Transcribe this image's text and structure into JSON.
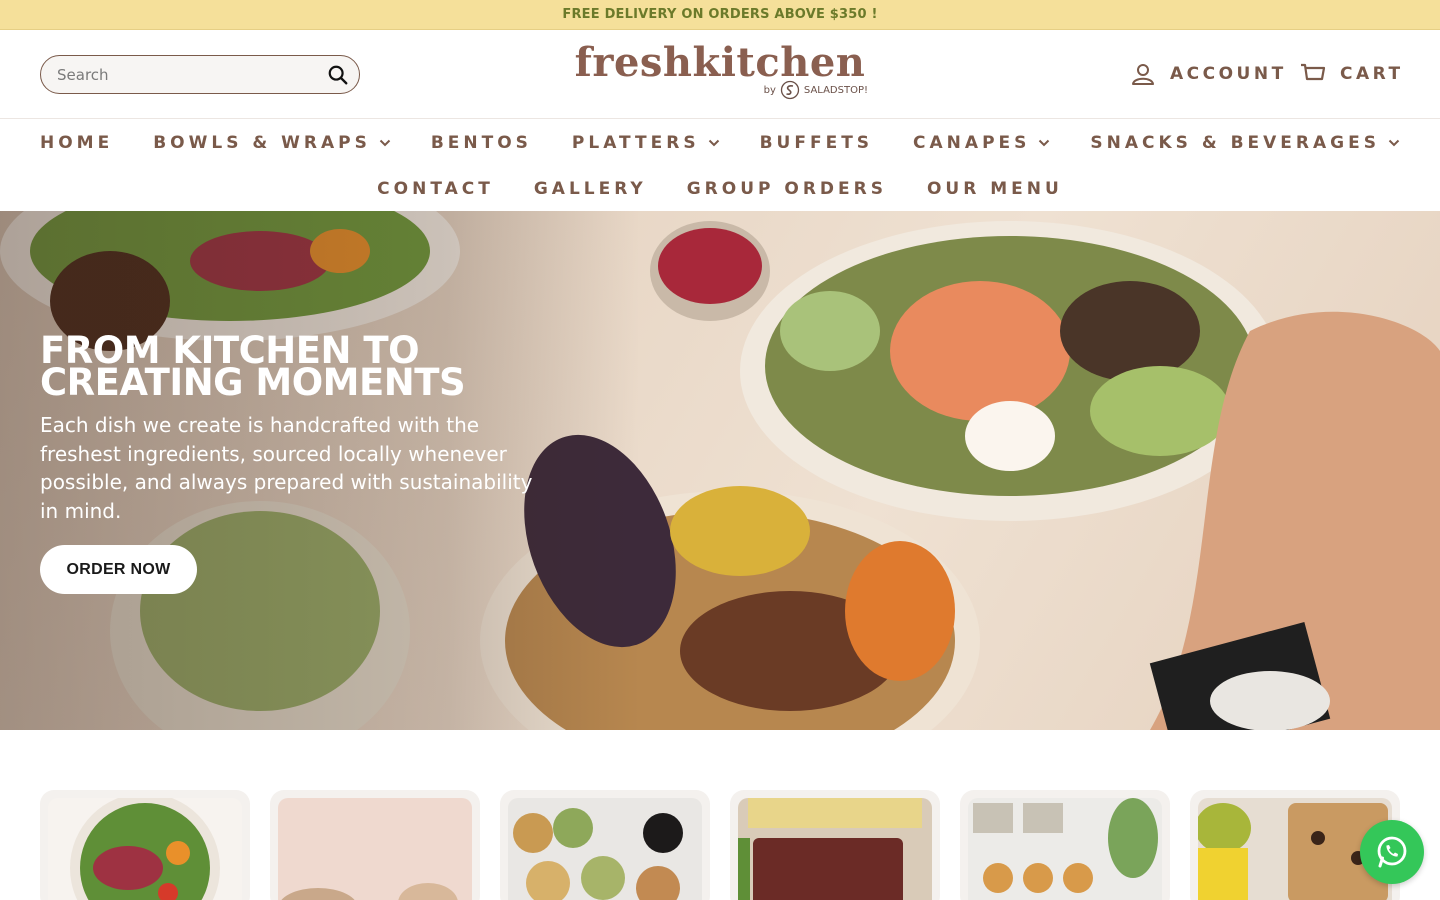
{
  "announcement": {
    "text": "FREE DELIVERY ON ORDERS ABOVE $350 !"
  },
  "header": {
    "search_placeholder": "Search",
    "logo_word": "freshkitchen",
    "logo_by": "by",
    "logo_partner": "SALADSTOP!",
    "account_label": "ACCOUNT",
    "cart_label": "CART"
  },
  "nav": {
    "row1": [
      {
        "label": "HOME",
        "dropdown": false
      },
      {
        "label": "BOWLS & WRAPS",
        "dropdown": true
      },
      {
        "label": "BENTOS",
        "dropdown": false
      },
      {
        "label": "PLATTERS",
        "dropdown": true
      },
      {
        "label": "BUFFETS",
        "dropdown": false
      },
      {
        "label": "CANAPES",
        "dropdown": true
      },
      {
        "label": "SNACKS & BEVERAGES",
        "dropdown": true
      }
    ],
    "row2": [
      {
        "label": "CONTACT",
        "dropdown": false
      },
      {
        "label": "GALLERY",
        "dropdown": false
      },
      {
        "label": "GROUP ORDERS",
        "dropdown": false
      },
      {
        "label": "OUR MENU",
        "dropdown": false
      }
    ]
  },
  "hero": {
    "title_line1": "FROM KITCHEN TO",
    "title_line2": "CREATING MOMENTS",
    "body": "Each dish we create is handcrafted with the freshest ingredients, sourced locally whenever possible, and always prepared with sustainability in mind.",
    "cta_label": "ORDER NOW"
  },
  "colors": {
    "brand": "#7a5a4a",
    "announcement_bg": "#f5e09a",
    "announcement_text": "#6b7a2a",
    "whatsapp": "#34c759"
  },
  "icons": {
    "search": "search-icon",
    "account": "user-icon",
    "cart": "cart-icon",
    "dropdown": "chevron-down-icon",
    "whatsapp": "whatsapp-icon"
  }
}
